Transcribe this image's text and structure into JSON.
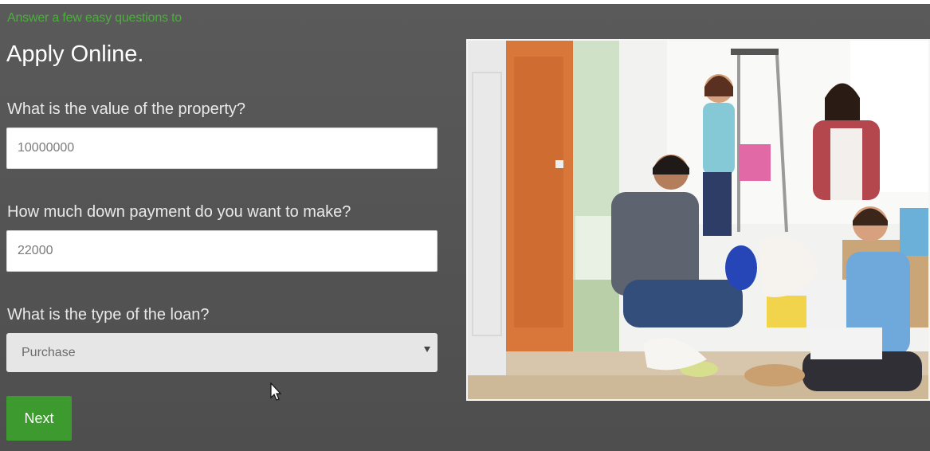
{
  "form": {
    "kicker": "Answer a few easy questions to",
    "title": "Apply Online.",
    "questions": [
      {
        "label": "What is the value of the property?",
        "value": "10000000"
      },
      {
        "label": "How much down payment do you want to make?",
        "value": "22000"
      },
      {
        "label": "What is the type of the loan?",
        "value": "Purchase"
      }
    ],
    "next_label": "Next"
  },
  "colors": {
    "accent_green": "#3d9a2f",
    "kicker_green": "#4dae3e",
    "background": "#555555"
  },
  "icons": {
    "select_caret": "chevron-down-icon",
    "cursor": "mouse-pointer-icon"
  }
}
